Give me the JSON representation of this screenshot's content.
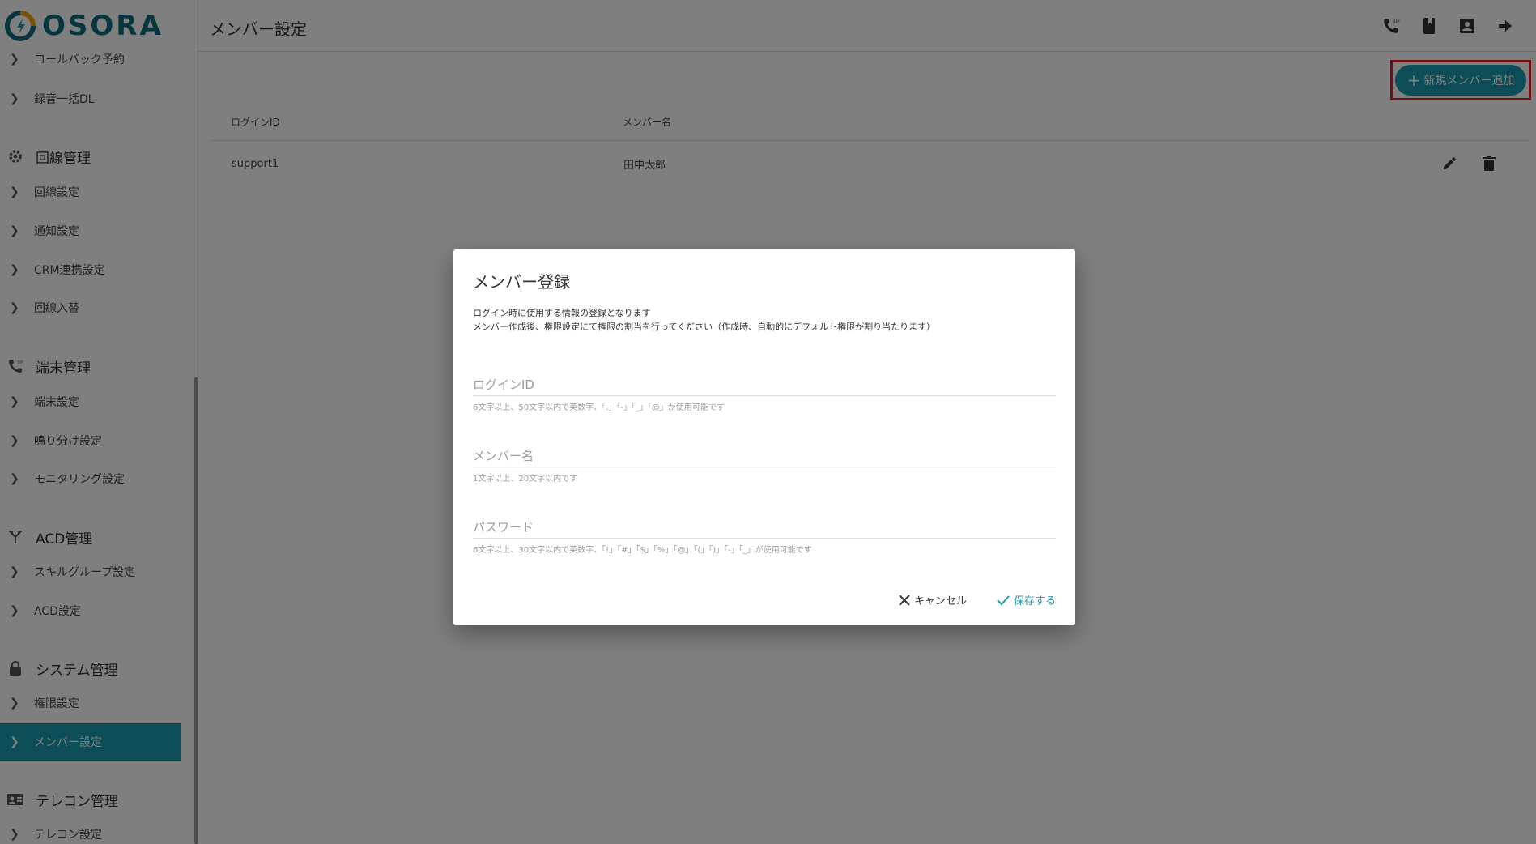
{
  "brand": {
    "name": "OSORA",
    "color": "#0e6d7c"
  },
  "accent": "#1a9bb0",
  "sidebar": {
    "items": [
      {
        "label": "コールバック予約",
        "icon": "chevron-right-icon"
      },
      {
        "label": "録音一括DL",
        "icon": "chevron-right-icon"
      },
      {
        "section": "回線管理",
        "icon": "gear-icon"
      },
      {
        "label": "回線設定",
        "icon": "chevron-right-icon"
      },
      {
        "label": "通知設定",
        "icon": "chevron-right-icon"
      },
      {
        "label": "CRM連携設定",
        "icon": "chevron-right-icon"
      },
      {
        "label": "回線入替",
        "icon": "chevron-right-icon"
      },
      {
        "section": "端末管理",
        "icon": "sip-phone-icon"
      },
      {
        "label": "端末設定",
        "icon": "chevron-right-icon"
      },
      {
        "label": "鳴り分け設定",
        "icon": "chevron-right-icon"
      },
      {
        "label": "モニタリング設定",
        "icon": "chevron-right-icon"
      },
      {
        "section": "ACD管理",
        "icon": "call-split-icon"
      },
      {
        "label": "スキルグループ設定",
        "icon": "chevron-right-icon"
      },
      {
        "label": "ACD設定",
        "icon": "chevron-right-icon"
      },
      {
        "section": "システム管理",
        "icon": "lock-icon"
      },
      {
        "label": "権限設定",
        "icon": "chevron-right-icon"
      },
      {
        "label": "メンバー設定",
        "icon": "chevron-right-icon",
        "active": true
      },
      {
        "section": "テレコン管理",
        "icon": "contact-card-icon"
      },
      {
        "label": "テレコン設定",
        "icon": "chevron-right-icon"
      }
    ]
  },
  "header": {
    "title": "メンバー設定",
    "icons": [
      "sip-phone-icon",
      "book-icon",
      "account-box-icon",
      "logout-arrow-icon"
    ]
  },
  "toolbar": {
    "add_label": "新規メンバー追加",
    "add_icon": "plus-icon"
  },
  "table": {
    "columns": [
      "ログインID",
      "メンバー名"
    ],
    "rows": [
      {
        "login_id": "support1",
        "name": "田中太郎",
        "actions": [
          "edit-pencil-icon",
          "delete-trash-icon"
        ]
      }
    ]
  },
  "dialog": {
    "title": "メンバー登録",
    "desc_line1": "ログイン時に使用する情報の登録となります",
    "desc_line2": "メンバー作成後、権限設定にて権限の割当を行ってください（作成時、自動的にデフォルト権限が割り当たります）",
    "fields": [
      {
        "label": "ログインID",
        "value": "",
        "hint": "6文字以上、50文字以内で英数字、「.」「-」「_」「@」が使用可能です"
      },
      {
        "label": "メンバー名",
        "value": "",
        "hint": "1文字以上、20文字以内です"
      },
      {
        "label": "パスワード",
        "value": "",
        "hint": "6文字以上、30文字以内で英数字、「!」「#」「$」「%」「@」「(」「)」「-」「_」が使用可能です"
      }
    ],
    "cancel_label": "キャンセル",
    "save_label": "保存する"
  }
}
